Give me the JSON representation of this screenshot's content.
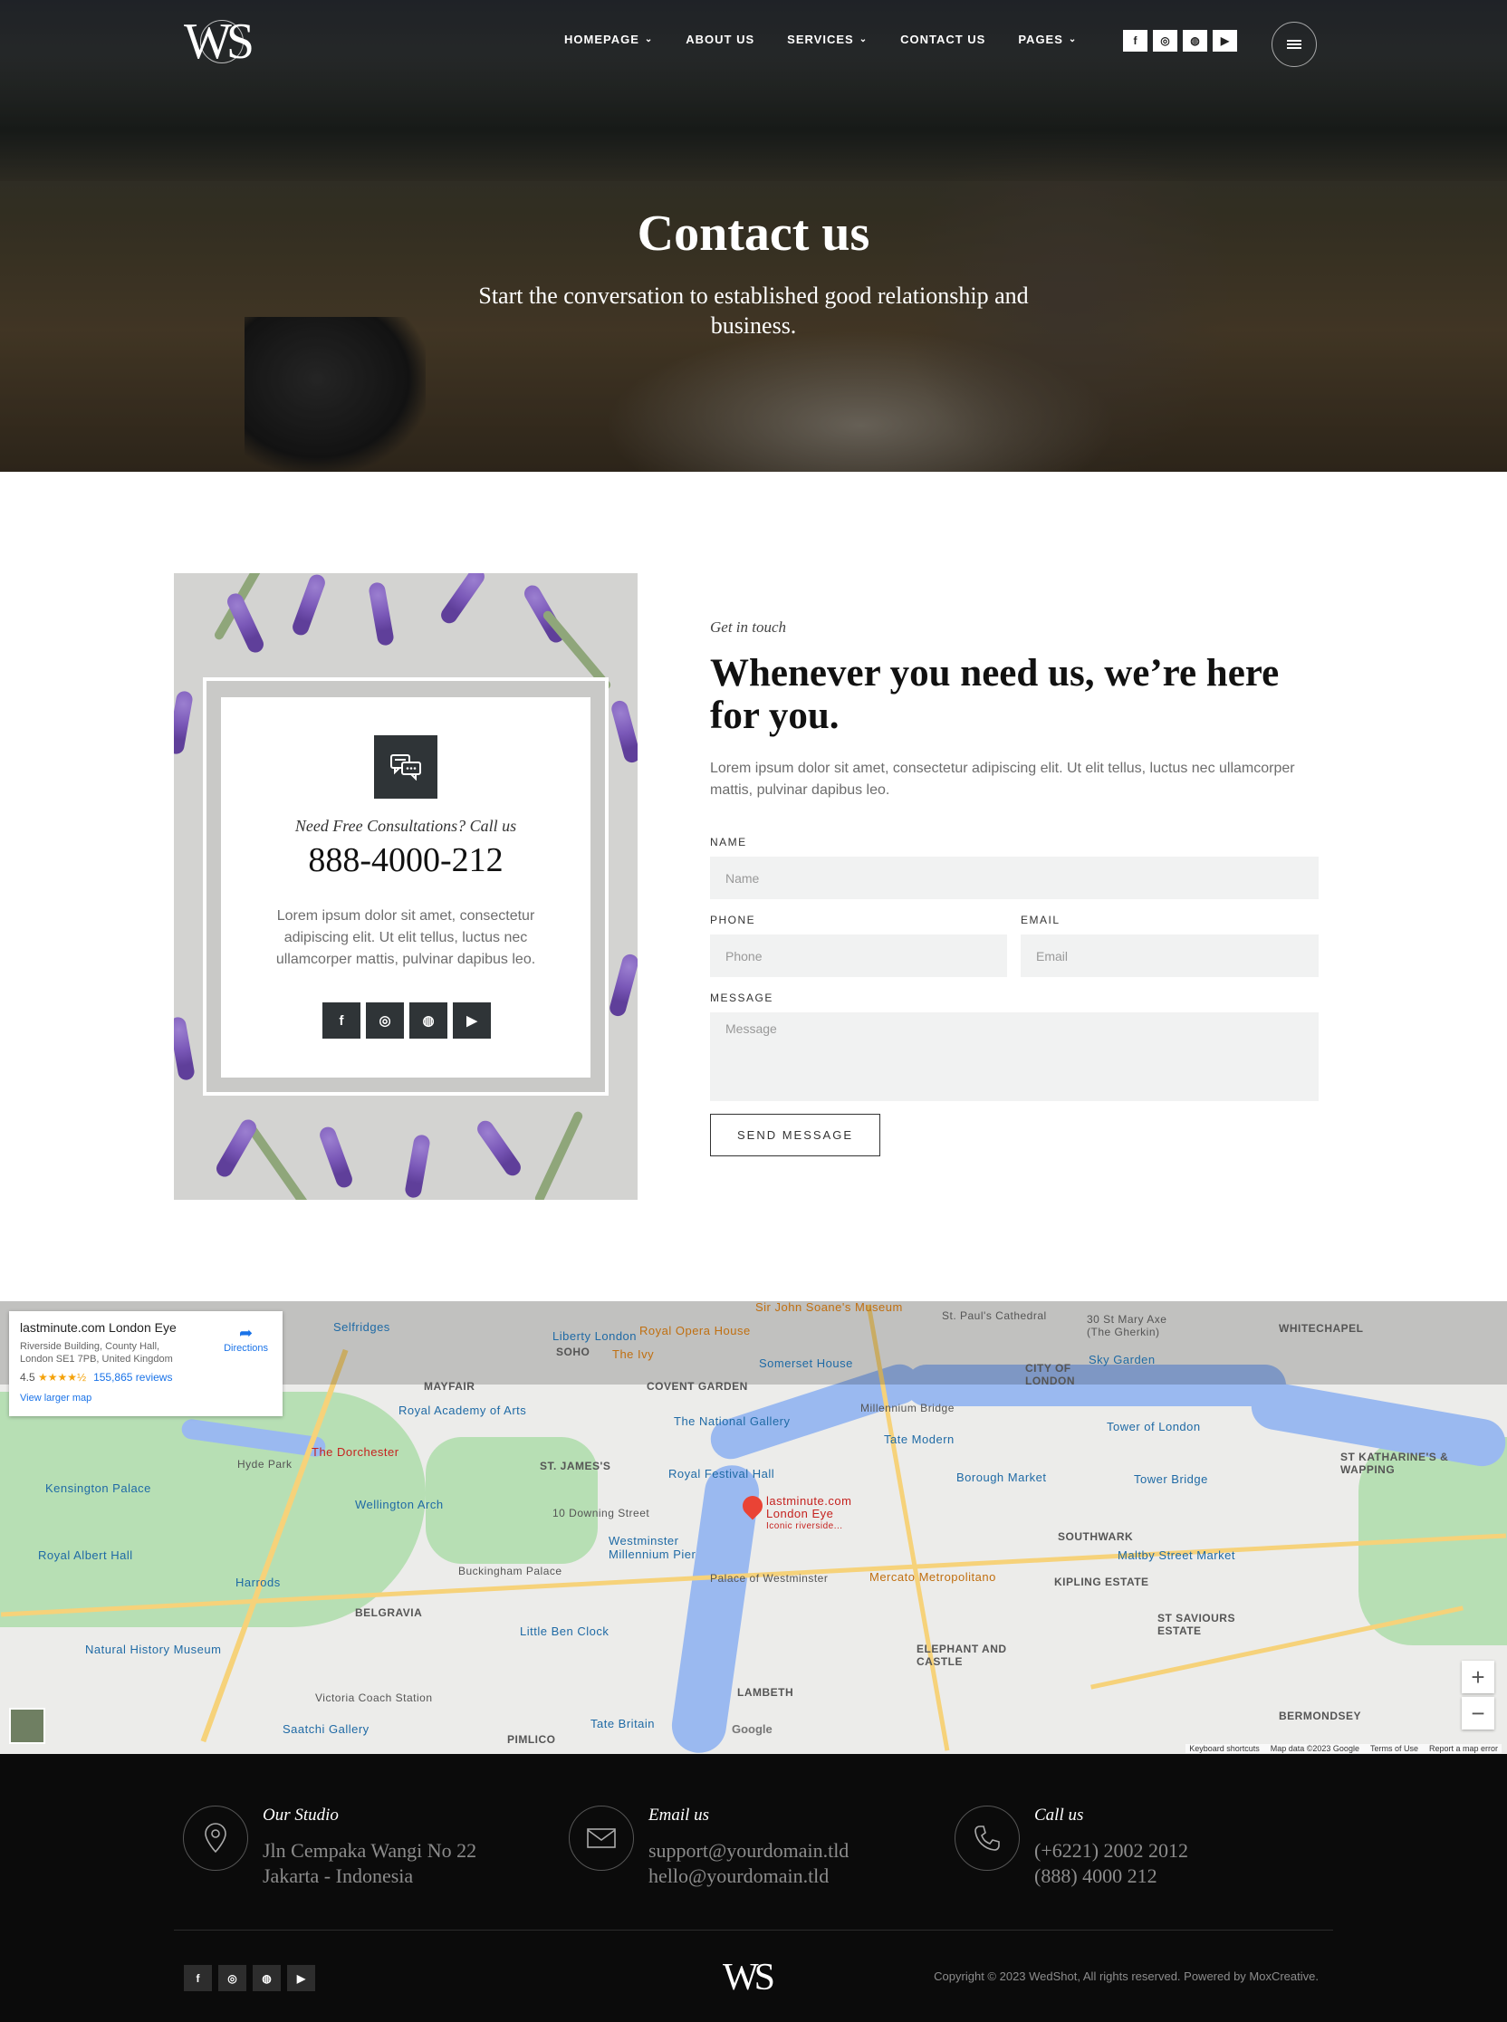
{
  "header": {
    "logo": "WS",
    "nav": [
      {
        "label": "HOMEPAGE",
        "dropdown": true
      },
      {
        "label": "ABOUT US",
        "dropdown": false
      },
      {
        "label": "SERVICES",
        "dropdown": true
      },
      {
        "label": "CONTACT US",
        "dropdown": false
      },
      {
        "label": "PAGES",
        "dropdown": true
      }
    ],
    "social_icons": [
      "facebook-icon",
      "instagram-icon",
      "dribbble-icon",
      "youtube-icon"
    ],
    "social_glyphs": [
      "f",
      "◎",
      "◍",
      "▶"
    ]
  },
  "hero": {
    "title": "Contact us",
    "subtitle": "Start the conversation to established good relationship and business."
  },
  "card": {
    "consult": "Need Free Consultations? Call us",
    "phone": "888-4000-212",
    "text": "Lorem ipsum dolor sit amet, consectetur adipiscing elit. Ut elit tellus, luctus nec ullamcorper mattis, pulvinar dapibus leo."
  },
  "contact": {
    "eyebrow": "Get in touch",
    "headline": "Whenever you need us, we’re here for you.",
    "intro": "Lorem ipsum dolor sit amet, consectetur adipiscing elit. Ut elit tellus, luctus nec ullamcorper mattis, pulvinar dapibus leo.",
    "form": {
      "name_label": "NAME",
      "name_placeholder": "Name",
      "phone_label": "PHONE",
      "phone_placeholder": "Phone",
      "email_label": "EMAIL",
      "email_placeholder": "Email",
      "message_label": "MESSAGE",
      "message_placeholder": "Message",
      "submit": "SEND MESSAGE"
    }
  },
  "map": {
    "info_title": "lastminute.com London Eye",
    "info_address": "Riverside Building, County Hall, London SE1 7PB, United Kingdom",
    "rating": "4.5",
    "stars": "★★★★½",
    "reviews": "155,865 reviews",
    "view_larger": "View larger map",
    "directions": "Directions",
    "pin_label": "lastminute.com London Eye",
    "pin_sub": "Iconic riverside...",
    "areas": [
      "SOHO",
      "MAYFAIR",
      "COVENT GARDEN",
      "CITY OF LONDON",
      "WHITECHAPEL",
      "ST. JAMES'S",
      "BELGRAVIA",
      "LAMBETH",
      "PIMLICO",
      "SOUTHWARK",
      "KIPLING ESTATE",
      "ELEPHANT AND CASTLE",
      "ST SAVIOURS ESTATE",
      "BERMONDSEY",
      "ST KATHARINE'S & WAPPING"
    ],
    "places": [
      "Selfridges",
      "Liberty London",
      "Royal Opera House",
      "Sir John Soane's Museum",
      "St. Paul's Cathedral",
      "30 St Mary Axe (The Gherkin)",
      "Sky Garden",
      "Royal Academy of Arts",
      "The National Gallery",
      "Millennium Bridge",
      "Tate Modern",
      "Tower of London",
      "Hyde Park",
      "The Dorchester",
      "Royal Festival Hall",
      "Borough Market",
      "Tower Bridge",
      "Kensington Palace",
      "Wellington Arch",
      "10 Downing Street",
      "Westminster Millennium Pier",
      "Royal Albert Hall",
      "Harrods",
      "Buckingham Palace",
      "Palace of Westminster",
      "Mercato Metropolitano",
      "Maltby Street Market",
      "Natural History Museum",
      "Little Ben Clock",
      "Victoria Coach Station",
      "Saatchi Gallery",
      "Tate Britain",
      "The Ivy",
      "Somerset House"
    ],
    "footer_links": [
      "Keyboard shortcuts",
      "Map data ©2023 Google",
      "Terms of Use",
      "Report a map error"
    ],
    "google": "Google"
  },
  "footer": {
    "studio_title": "Our Studio",
    "studio_line1": "Jln Cempaka Wangi No 22",
    "studio_line2": "Jakarta - Indonesia",
    "email_title": "Email us",
    "email_line1": "support@yourdomain.tld",
    "email_line2": "hello@yourdomain.tld",
    "call_title": "Call us",
    "call_line1": "(+6221) 2002 2012",
    "call_line2": "(888) 4000 212",
    "logo": "WS",
    "copyright": "Copyright © 2023 WedShot, All rights reserved. Powered by MoxCreative."
  }
}
